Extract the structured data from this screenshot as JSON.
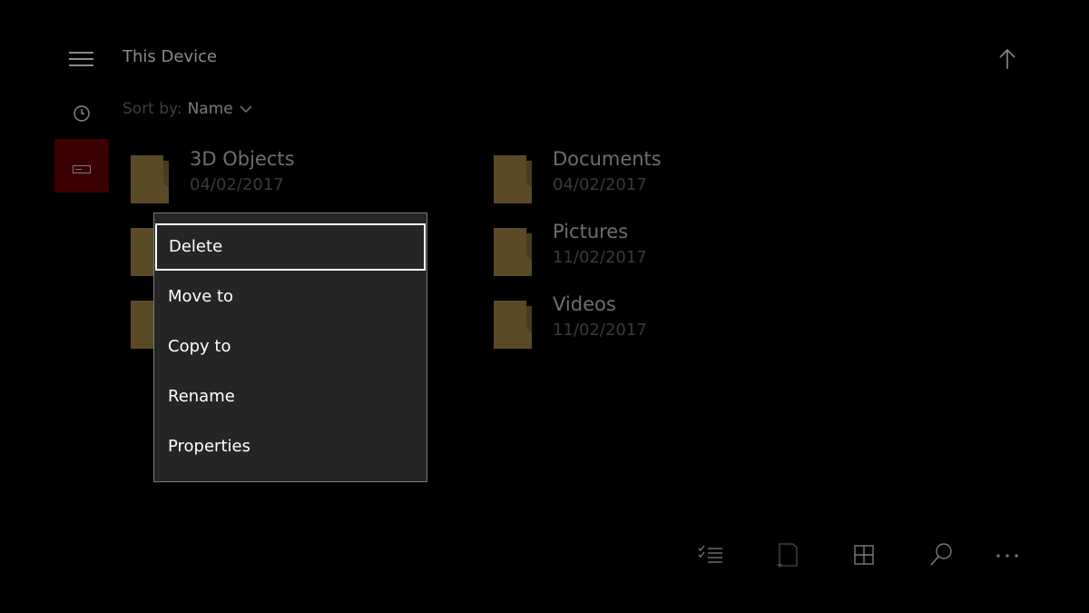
{
  "header": {
    "title": "This Device"
  },
  "sort": {
    "label": "Sort by:",
    "value": "Name"
  },
  "folders": [
    {
      "name": "3D Objects",
      "date": "04/02/2017"
    },
    {
      "name": "Documents",
      "date": "04/02/2017"
    },
    {
      "name": "Pictures",
      "date": "11/02/2017"
    },
    {
      "name": "Videos",
      "date": "11/02/2017"
    }
  ],
  "context_menu": {
    "items": [
      {
        "label": "Delete",
        "focused": true
      },
      {
        "label": "Move to"
      },
      {
        "label": "Copy to"
      },
      {
        "label": "Rename"
      },
      {
        "label": "Properties"
      }
    ]
  },
  "icons": {
    "hamburger": "hamburger-menu-icon",
    "recent": "clock-icon",
    "device": "drive-icon",
    "up": "up-arrow-icon",
    "select": "multi-select-icon",
    "new_folder": "new-folder-icon",
    "view": "grid-view-icon",
    "search": "search-icon",
    "more": "more-icon"
  },
  "colors": {
    "background": "#000000",
    "menu_background": "#252525",
    "folder": "#5a4a26",
    "accent_nav": "#3c0000"
  }
}
